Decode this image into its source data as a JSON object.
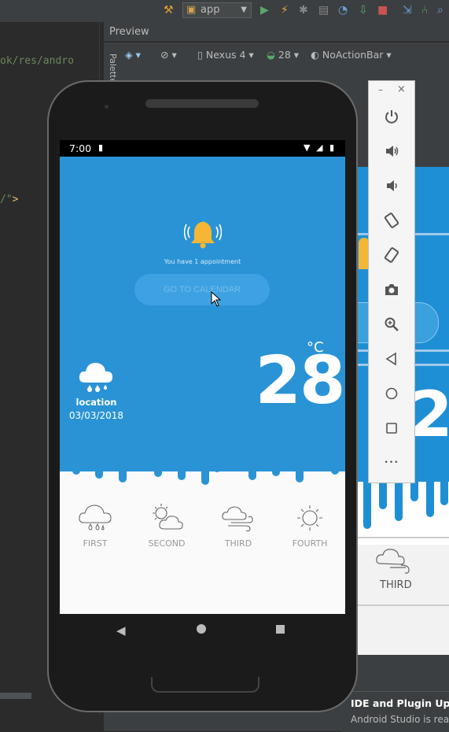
{
  "ide": {
    "run_config": "app",
    "preview_title": "Preview",
    "palette_label": "Palette",
    "device": "Nexus 4",
    "api": "28",
    "theme": "NoActionBar",
    "code_line_1": "ok/res/andro",
    "code_line_2_a": "/\"",
    "code_line_2_b": ">",
    "notification": {
      "title": "IDE and Plugin Upda",
      "text": "Android Studio is rea"
    },
    "blueprint_third": "THIRD"
  },
  "phone": {
    "status_time": "7:00",
    "appointment_text": "You have 1 appointment",
    "calendar_button": "GO TO CALENDAR",
    "location": "location",
    "date": "03/03/2018",
    "temperature": "28",
    "unit": "°C",
    "forecast": [
      {
        "label": "FIRST",
        "icon": "rain-cloud-icon"
      },
      {
        "label": "SECOND",
        "icon": "sun-cloud-icon"
      },
      {
        "label": "THIRD",
        "icon": "wind-cloud-icon"
      },
      {
        "label": "FOURTH",
        "icon": "sun-icon"
      }
    ]
  },
  "emulator_panel": {
    "minimize": "–",
    "close": "×",
    "more": "•••",
    "buttons": [
      "power-icon",
      "volume-up-icon",
      "volume-down-icon",
      "rotate-left-icon",
      "rotate-right-icon",
      "camera-icon",
      "zoom-icon",
      "back-icon",
      "home-icon",
      "overview-icon"
    ]
  },
  "colors": {
    "app_blue": "#2a93d5",
    "ide_bg": "#2b2b2b",
    "ide_panel": "#3c3f41"
  }
}
